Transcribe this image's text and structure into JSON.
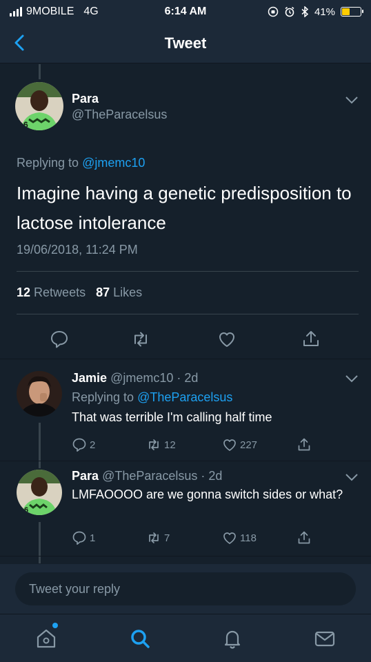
{
  "status_bar": {
    "carrier": "9MOBILE",
    "network": "4G",
    "time": "6:14 AM",
    "battery_percent": "41%",
    "battery_level": 0.41,
    "battery_color": "#ffcc00"
  },
  "nav": {
    "back_icon": "chevron-left-icon",
    "title": "Tweet"
  },
  "main_tweet": {
    "name": "Para",
    "handle": "@TheParacelsus",
    "replying_prefix": "Replying to",
    "replying_to": "@jmemc10",
    "text": "Imagine having a genetic predisposition to lactose intolerance",
    "timestamp": "19/06/2018, 11:24 PM",
    "retweets_count": "12",
    "retweets_label": "Retweets",
    "likes_count": "87",
    "likes_label": "Likes"
  },
  "replies": [
    {
      "name": "Jamie",
      "handle": "@jmemc10",
      "time": "· 2d",
      "replying_prefix": "Replying to",
      "replying_to": "@TheParacelsus",
      "text": "That was terrible I'm calling half time",
      "reply_count": "2",
      "retweet_count": "12",
      "like_count": "227"
    },
    {
      "name": "Para",
      "handle": "@TheParacelsus",
      "time": "· 2d",
      "text": "LMFAOOOO are we gonna switch sides or what?",
      "reply_count": "1",
      "retweet_count": "7",
      "like_count": "118"
    }
  ],
  "composer": {
    "placeholder": "Tweet your reply"
  },
  "tabbar": {
    "items": [
      "home-icon",
      "search-icon",
      "notifications-icon",
      "messages-icon"
    ]
  },
  "colors": {
    "background": "#15202b",
    "bar": "#1c2938",
    "accent": "#1da1f2",
    "muted": "#8899a6",
    "divider": "#38444d"
  }
}
